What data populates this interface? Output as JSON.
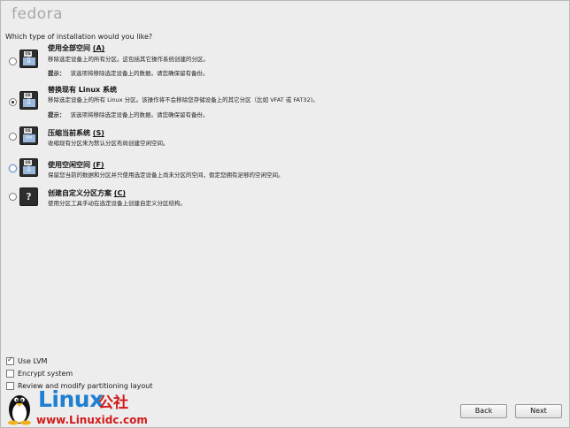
{
  "brand": {
    "logo_text": "fedora"
  },
  "question": "Which type of installation would you like?",
  "options": [
    {
      "title": "使用全部空间",
      "key": "(A)",
      "desc": "移除选定设备上的所有分区。这包括其它操作系统创建的分区。",
      "tip_label": "提示：",
      "tip_text": "该选项将移除选定设备上的数据。请您确保留有备份。",
      "icon_os": "OS",
      "icon": "remove-all-icon",
      "selected": false
    },
    {
      "title": "替换现有 Linux 系统",
      "key": "",
      "desc": "移除选定设备上的所有 Linux 分区。该操作将不会移除您存储设备上的其它分区（比如 VFAT 或 FAT32)。",
      "tip_label": "提示：",
      "tip_text": "该选项将移除选定设备上的数据。请您确保留有备份。",
      "icon_os": "OS",
      "icon": "replace-linux-icon",
      "selected": true
    },
    {
      "title": "压缩当前系统",
      "key": "(S)",
      "desc": "收缩现有分区来为默认分区布局创建空闲空间。",
      "tip_label": "",
      "tip_text": "",
      "icon_os": "OS",
      "icon": "shrink-icon",
      "selected": false
    },
    {
      "title": "使用空闲空间",
      "key": "(F)",
      "desc": "保留您当前的数据和分区并只使用选定设备上尚未分区的空间，假定您拥有足够的空闲空间。",
      "tip_label": "",
      "tip_text": "",
      "icon_os": "OS",
      "icon": "free-space-icon",
      "selected": false
    },
    {
      "title": "创建自定义分区方案",
      "key": "(C)",
      "desc": "使用分区工具手动在选定设备上创建自定义分区结构。",
      "tip_label": "",
      "tip_text": "",
      "icon_os": "?",
      "icon": "custom-layout-icon",
      "selected": false
    }
  ],
  "checkboxes": [
    {
      "label": "Use LVM",
      "checked": true
    },
    {
      "label": "Encrypt system",
      "checked": false
    },
    {
      "label": "Review and modify partitioning layout",
      "checked": false
    }
  ],
  "buttons": {
    "back": "Back",
    "next": "Next"
  },
  "watermark": {
    "big": "Linux",
    "cn": "公社",
    "url": "www.Linuxidc.com"
  }
}
